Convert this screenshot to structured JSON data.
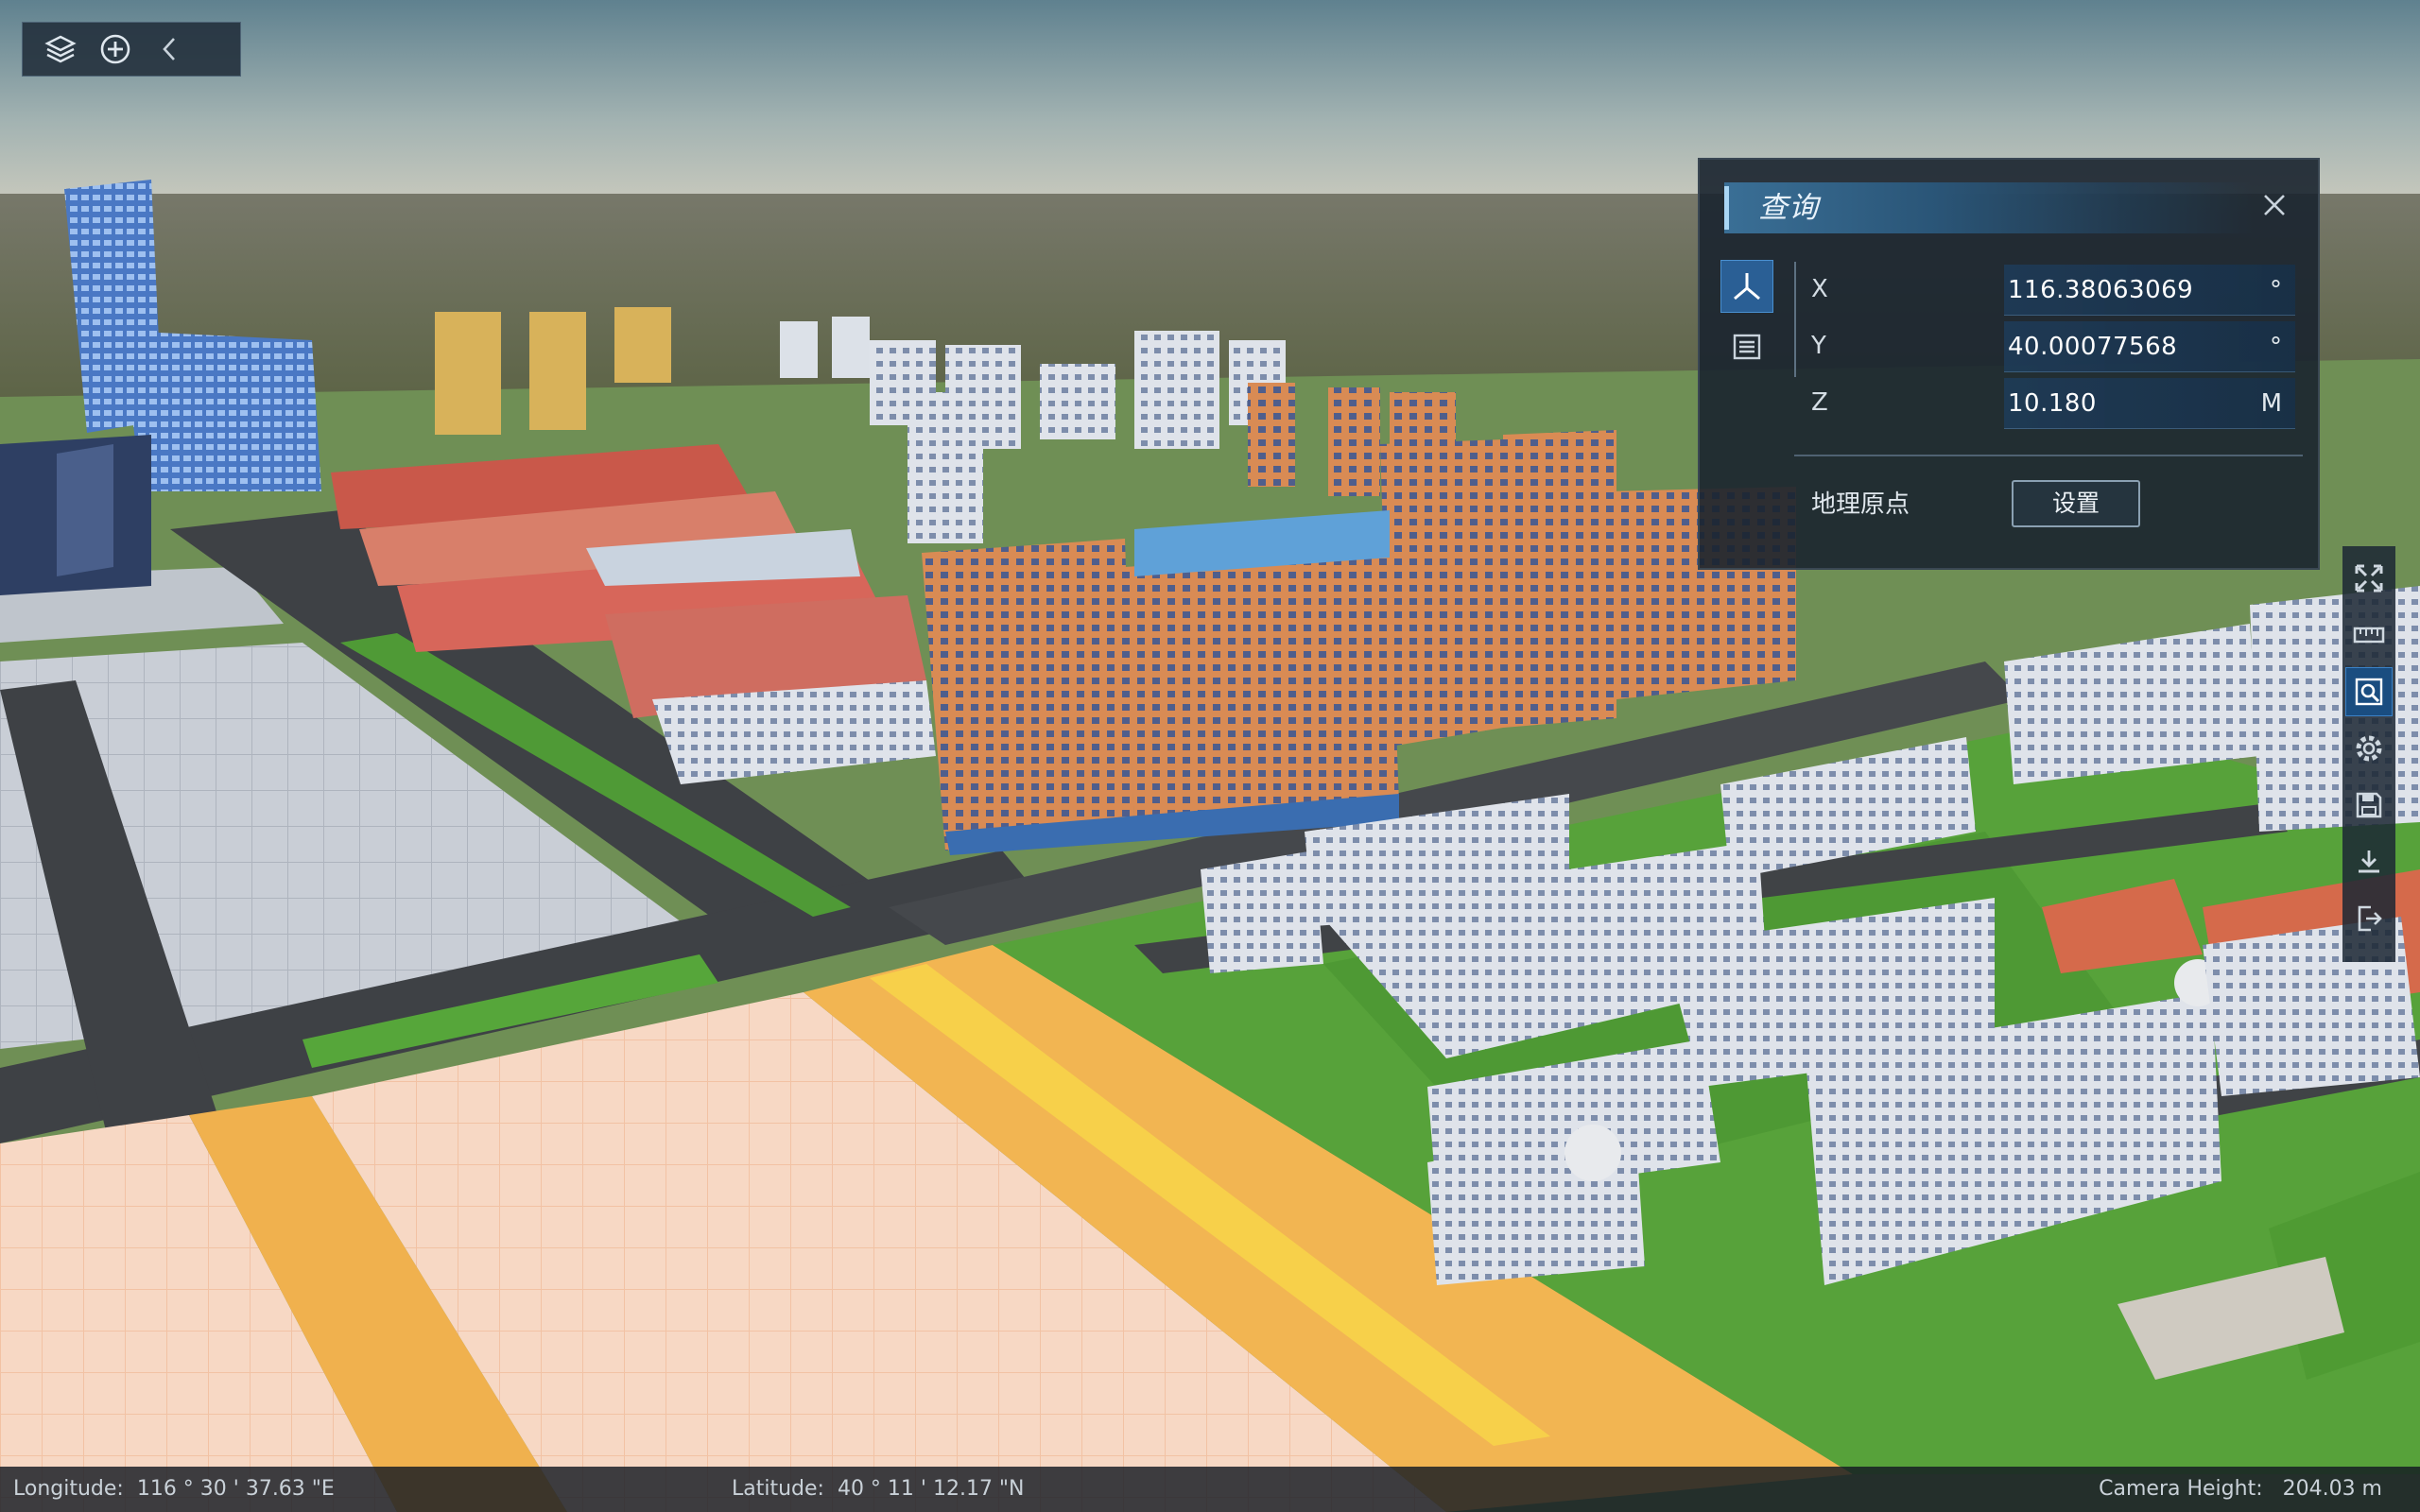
{
  "toolbar": {
    "buttons": [
      {
        "icon": "layers-icon"
      },
      {
        "icon": "add-circle-icon"
      },
      {
        "icon": "chevron-left-icon"
      }
    ]
  },
  "query_panel": {
    "title": "查询",
    "close_icon": "close-icon",
    "mode_icons": [
      "pick-point-icon",
      "list-icon"
    ],
    "coordinates": [
      {
        "axis": "X",
        "value": "116.38063069",
        "unit": "°"
      },
      {
        "axis": "Y",
        "value": "40.00077568",
        "unit": "°"
      },
      {
        "axis": "Z",
        "value": "10.180",
        "unit": "M"
      }
    ],
    "origin_label": "地理原点",
    "set_button": "设置"
  },
  "side_tools": [
    {
      "icon": "fullscreen-icon",
      "active": false
    },
    {
      "icon": "ruler-icon",
      "active": false
    },
    {
      "icon": "query-icon",
      "active": true
    },
    {
      "icon": "settings-icon",
      "active": false
    },
    {
      "icon": "save-icon",
      "active": false
    },
    {
      "icon": "download-icon",
      "active": false
    },
    {
      "icon": "exit-icon",
      "active": false
    }
  ],
  "status_bar": {
    "longitude": "Longitude:  116 ° 30 ' 37.63 \"E",
    "latitude": "Latitude:  40 ° 11 ' 12.17 \"N",
    "camera_height": "Camera Height:   204.03 m"
  },
  "colors": {
    "panel_bg": "#1a242f",
    "panel_header": "#2a5577",
    "accent_active": "#2a5f95",
    "status_bar_bg": "#141a22"
  }
}
